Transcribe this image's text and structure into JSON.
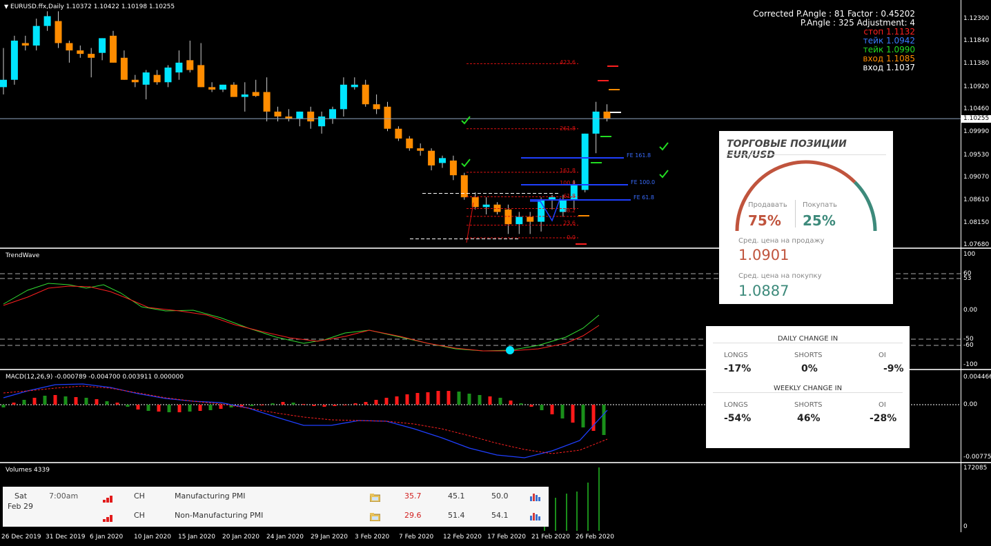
{
  "main_chart": {
    "title": "EURUSD.ffx,Daily  1.10372 1.10422 1.10198 1.10255",
    "price_ticks": [
      "1.12300",
      "1.11840",
      "1.11380",
      "1.10920",
      "1.10460",
      "1.09990",
      "1.09530",
      "1.09070",
      "1.08610",
      "1.08150",
      "1.07680"
    ],
    "current_price": "1.10255",
    "info": [
      {
        "text": "Corrected P.Angle : 81   Factor : 0.45202",
        "color": "#ffffff"
      },
      {
        "text": "P.Angle : 325   Adjustment: 4",
        "color": "#ffffff"
      },
      {
        "text": "стоп  1.1132",
        "color": "#ff2020"
      },
      {
        "text": "тейк  1.0942",
        "color": "#3a7dff"
      },
      {
        "text": "тейк  1.0990",
        "color": "#22dd22"
      },
      {
        "text": "вход  1.1085",
        "color": "#ff8c00"
      },
      {
        "text": "вход  1.1037",
        "color": "#ffffff"
      }
    ],
    "fib_labels": [
      "423.6",
      "261.8",
      "161.8",
      "100.0",
      "61.8",
      "38.2",
      "23.6",
      "0.0"
    ],
    "fe_labels": [
      "FE 161.8",
      "FE 100.0",
      "FE 61.8"
    ]
  },
  "chart_data": {
    "type": "candlestick",
    "symbol": "EURUSD.ffx",
    "timeframe": "Daily",
    "ohlc": {
      "open": 1.10372,
      "high": 1.10422,
      "low": 1.10198,
      "close": 1.10255
    },
    "ylim": [
      1.0768,
      1.23
    ],
    "dates": [
      "26 Dec 2019",
      "31 Dec 2019",
      "6 Jan 2020",
      "10 Jan 2020",
      "15 Jan 2020",
      "20 Jan 2020",
      "24 Jan 2020",
      "29 Jan 2020",
      "3 Feb 2020",
      "7 Feb 2020",
      "12 Feb 2020",
      "17 Feb 2020",
      "21 Feb 2020",
      "26 Feb 2020"
    ],
    "candles": [
      [
        1.109,
        1.117,
        1.1075,
        1.1105
      ],
      [
        1.1105,
        1.1195,
        1.1095,
        1.1185
      ],
      [
        1.118,
        1.1195,
        1.1165,
        1.1175
      ],
      [
        1.1175,
        1.123,
        1.1165,
        1.1215
      ],
      [
        1.1215,
        1.1245,
        1.1205,
        1.1235
      ],
      [
        1.1225,
        1.1245,
        1.117,
        1.118
      ],
      [
        1.118,
        1.1185,
        1.114,
        1.1165
      ],
      [
        1.1165,
        1.1175,
        1.115,
        1.1158
      ],
      [
        1.1158,
        1.117,
        1.111,
        1.115
      ],
      [
        1.116,
        1.119,
        1.1145,
        1.119
      ],
      [
        1.1195,
        1.1205,
        1.114,
        1.114
      ],
      [
        1.115,
        1.1165,
        1.1105,
        1.1105
      ],
      [
        1.1105,
        1.1115,
        1.109,
        1.11
      ],
      [
        1.1095,
        1.1125,
        1.1065,
        1.112
      ],
      [
        1.1115,
        1.1125,
        1.1095,
        1.11
      ],
      [
        1.11,
        1.1135,
        1.109,
        1.113
      ],
      [
        1.112,
        1.1165,
        1.1105,
        1.114
      ],
      [
        1.1145,
        1.1185,
        1.112,
        1.1125
      ],
      [
        1.1135,
        1.118,
        1.109,
        1.109
      ],
      [
        1.109,
        1.11,
        1.108,
        1.1085
      ],
      [
        1.1085,
        1.1095,
        1.108,
        1.1095
      ],
      [
        1.1095,
        1.11,
        1.107,
        1.107
      ],
      [
        1.107,
        1.11,
        1.104,
        1.1075
      ],
      [
        1.108,
        1.1105,
        1.107,
        1.1072
      ],
      [
        1.108,
        1.111,
        1.102,
        1.104
      ],
      [
        1.104,
        1.105,
        1.102,
        1.103
      ],
      [
        1.103,
        1.1045,
        1.102,
        1.1025
      ],
      [
        1.1025,
        1.104,
        1.101,
        1.104
      ],
      [
        1.104,
        1.105,
        1.1005,
        1.102
      ],
      [
        1.101,
        1.104,
        1.0995,
        1.103
      ],
      [
        1.1025,
        1.105,
        1.1015,
        1.1045
      ],
      [
        1.1045,
        1.111,
        1.103,
        1.1095
      ],
      [
        1.109,
        1.111,
        1.1085,
        1.1095
      ],
      [
        1.1095,
        1.1105,
        1.105,
        1.1055
      ],
      [
        1.1055,
        1.1075,
        1.1035,
        1.1045
      ],
      [
        1.105,
        1.106,
        1.1,
        1.1005
      ],
      [
        1.1005,
        1.101,
        1.098,
        1.0985
      ],
      [
        1.0985,
        1.099,
        1.096,
        1.0965
      ],
      [
        1.0965,
        1.0975,
        1.095,
        1.096
      ],
      [
        1.096,
        1.0965,
        1.092,
        1.093
      ],
      [
        1.0935,
        1.095,
        1.0925,
        1.0945
      ],
      [
        1.094,
        1.095,
        1.09,
        1.091
      ],
      [
        1.091,
        1.0915,
        1.086,
        1.0865
      ],
      [
        1.0865,
        1.0875,
        1.084,
        1.0845
      ],
      [
        1.0845,
        1.0865,
        1.083,
        1.085
      ],
      [
        1.085,
        1.0855,
        1.083,
        1.0835
      ],
      [
        1.084,
        1.085,
        1.079,
        1.081
      ],
      [
        1.081,
        1.0835,
        1.079,
        1.0825
      ],
      [
        1.0825,
        1.0835,
        1.079,
        1.0815
      ],
      [
        1.0815,
        1.0865,
        1.0795,
        1.086
      ],
      [
        1.086,
        1.087,
        1.084,
        1.0865
      ],
      [
        1.0835,
        1.087,
        1.0825,
        1.086
      ],
      [
        1.086,
        1.09,
        1.084,
        1.089
      ],
      [
        1.088,
        1.0995,
        1.0875,
        1.0995
      ],
      [
        1.0995,
        1.106,
        1.0955,
        1.104
      ],
      [
        1.104,
        1.1055,
        1.102,
        1.1026
      ]
    ]
  },
  "trendwave": {
    "title": "TrendWave",
    "ticks": [
      "100",
      "60",
      "53",
      "0.00",
      "-50",
      "-60",
      "-100"
    ]
  },
  "macd": {
    "title": "MACD(12,26,9) -0.000789 -0.004700 0.003911 0.000000",
    "ticks": [
      "0.004466",
      "0.00",
      "-0.007758"
    ]
  },
  "volumes": {
    "title": "Volumes 4339",
    "ticks": [
      "172085",
      "0"
    ]
  },
  "economic_calendar": {
    "day": "Sat",
    "date": "Feb 29",
    "time": "7:00am",
    "rows": [
      {
        "country": "CH",
        "event": "Manufacturing PMI",
        "actual": "35.7",
        "forecast": "45.1",
        "previous": "50.0"
      },
      {
        "country": "CH",
        "event": "Non-Manufacturing PMI",
        "actual": "29.6",
        "forecast": "51.4",
        "previous": "54.1"
      }
    ]
  },
  "positions_widget": {
    "title": "ТОРГОВЫЕ ПОЗИЦИИ EUR/USD",
    "sell_label": "Продавать",
    "sell_pct": "75%",
    "buy_label": "Покупать",
    "buy_pct": "25%",
    "sell_fraction": 0.75,
    "avg_sell_label": "Сред. цена на продажу",
    "avg_sell": "1.0901",
    "avg_buy_label": "Сред. цена на покупку",
    "avg_buy": "1.0887",
    "colors": {
      "sell": "#c0543d",
      "buy": "#3d8a7b"
    }
  },
  "change_widget": {
    "daily_title": "DAILY CHANGE IN",
    "weekly_title": "WEEKLY CHANGE IN",
    "headers": [
      "LONGS",
      "SHORTS",
      "OI"
    ],
    "daily": [
      "-17%",
      "0%",
      "-9%"
    ],
    "weekly": [
      "-54%",
      "46%",
      "-28%"
    ]
  },
  "colors": {
    "bull": "#00e5ff",
    "bear": "#ff8c00"
  }
}
